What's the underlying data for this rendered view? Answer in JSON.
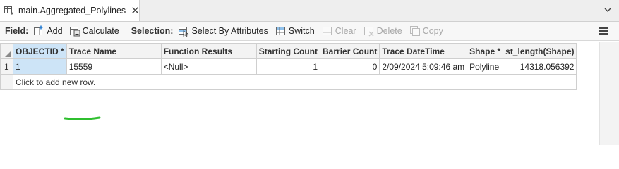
{
  "tab": {
    "title": "main.Aggregated_Polylines",
    "close_glyph": "✕",
    "icon": "table-icon",
    "menu_icon": "chevron-down-icon"
  },
  "toolbar": {
    "field_label": "Field:",
    "add_label": "Add",
    "calculate_label": "Calculate",
    "selection_label": "Selection:",
    "select_by_attributes_label": "Select By Attributes",
    "switch_label": "Switch",
    "clear_label": "Clear",
    "delete_label": "Delete",
    "copy_label": "Copy",
    "menu_icon": "hamburger-menu-icon"
  },
  "grid": {
    "columns": [
      "OBJECTID *",
      "Trace Name",
      "Function Results",
      "Starting Count",
      "Barrier Count",
      "Trace DateTime",
      "Shape *",
      "st_length(Shape)"
    ],
    "rows": [
      {
        "row_number": "1",
        "OBJECTID": "1",
        "Trace Name": "15559",
        "Function Results": "<Null>",
        "Starting Count": "1",
        "Barrier Count": "0",
        "Trace DateTime": "2/09/2024 5:09:46 am",
        "Shape": "Polyline",
        "st_length": "14318.056392"
      }
    ],
    "new_row_text": "Click to add new row."
  },
  "colors": {
    "selected_column": "#cde4f7",
    "annotation_underline": "#2fbf2f"
  }
}
